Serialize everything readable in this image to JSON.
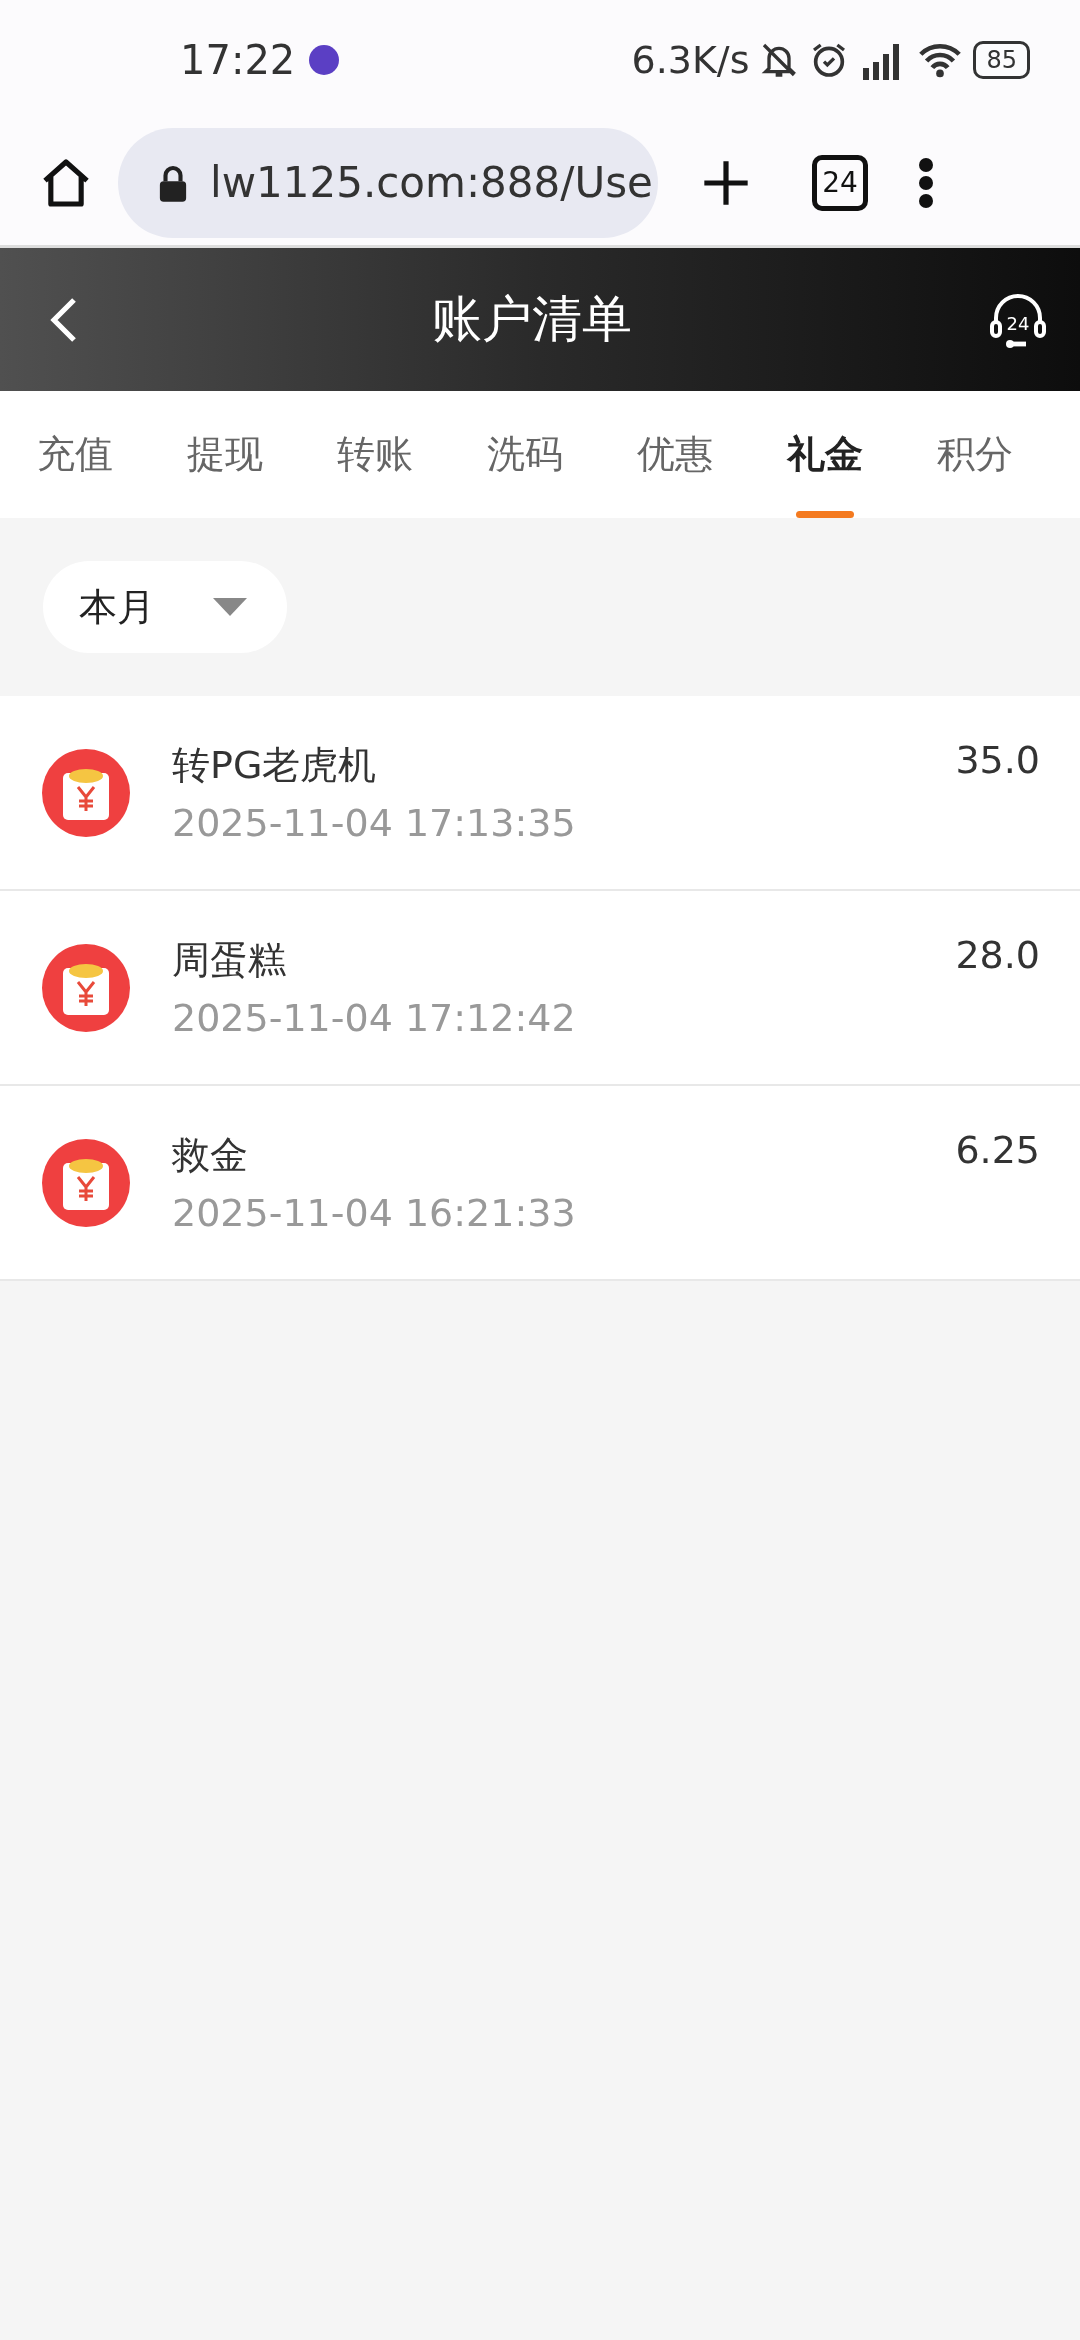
{
  "status_bar": {
    "time": "17:22",
    "network_speed": "6.3K/s",
    "battery": "85"
  },
  "browser": {
    "url": "lw1125.com:888/Use",
    "tab_count": "24"
  },
  "header": {
    "title": "账户清单",
    "support_badge": "24"
  },
  "tabs": [
    {
      "label": "充值",
      "selected": false
    },
    {
      "label": "提现",
      "selected": false
    },
    {
      "label": "转账",
      "selected": false
    },
    {
      "label": "洗码",
      "selected": false
    },
    {
      "label": "优惠",
      "selected": false
    },
    {
      "label": "礼金",
      "selected": true
    },
    {
      "label": "积分",
      "selected": false
    }
  ],
  "filter": {
    "label": "本月"
  },
  "records": [
    {
      "title": "转PG老虎机",
      "time": "2025-11-04 17:13:35",
      "amount": "35.0"
    },
    {
      "title": "周蛋糕",
      "time": "2025-11-04 17:12:42",
      "amount": "28.0"
    },
    {
      "title": "救金",
      "time": "2025-11-04 16:21:33",
      "amount": "6.25"
    }
  ]
}
